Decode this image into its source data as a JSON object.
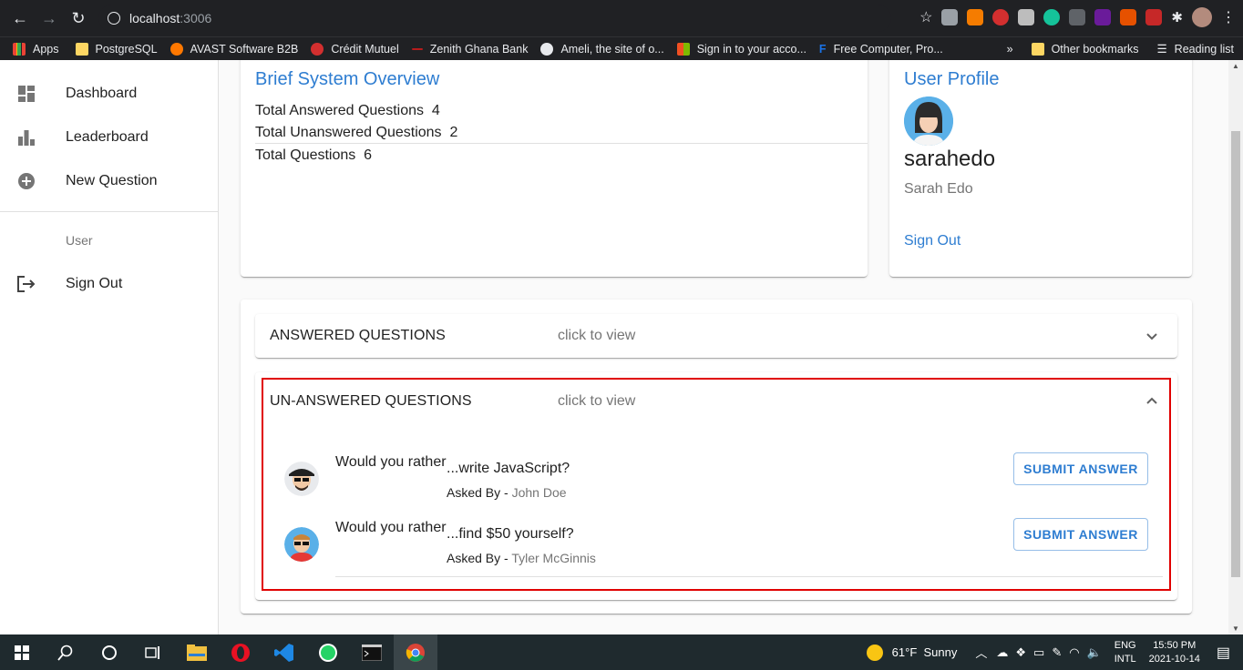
{
  "browser": {
    "url_host": "localhost",
    "url_port": ":3006",
    "bookmarks": [
      "Apps",
      "PostgreSQL",
      "AVAST Software B2B",
      "Crédit Mutuel",
      "Zenith Ghana Bank",
      "Ameli, the site of o...",
      "Sign in to your acco...",
      "Free Computer, Pro..."
    ],
    "other_bookmarks": "Other bookmarks",
    "reading_list": "Reading list",
    "chevron": "»"
  },
  "sidebar": {
    "items": [
      {
        "label": "Dashboard",
        "icon": "dashboard-icon"
      },
      {
        "label": "Leaderboard",
        "icon": "bar-chart-icon"
      },
      {
        "label": "New Question",
        "icon": "add-circle-icon"
      }
    ],
    "section_label": "User",
    "sign_out": "Sign Out"
  },
  "overview": {
    "title": "Brief System Overview",
    "answered": "Total Answered Questions  4",
    "unanswered": "Total Unanswered Questions  2",
    "total": "Total Questions  6"
  },
  "profile": {
    "title": "User Profile",
    "username": "sarahedo",
    "full_name": "Sarah Edo",
    "sign_out": "Sign Out"
  },
  "answered_panel": {
    "title": "ANSWERED QUESTIONS",
    "hint": "click to view"
  },
  "unanswered_panel": {
    "title": "UN-ANSWERED QUESTIONS",
    "hint": "click to view",
    "questions": [
      {
        "prefix": "Would you rather",
        "text": "...write JavaScript?",
        "asked_by_label": "Asked By - ",
        "author": "John Doe",
        "button": "SUBMIT ANSWER"
      },
      {
        "prefix": "Would you rather",
        "text": "...find $50 yourself?",
        "asked_by_label": "Asked By - ",
        "author": "Tyler McGinnis",
        "button": "SUBMIT ANSWER"
      }
    ]
  },
  "taskbar": {
    "weather": "61°F  Sunny",
    "lang1": "ENG",
    "lang2": "INTL",
    "time": "15:50 PM",
    "date": "2021-10-14"
  }
}
